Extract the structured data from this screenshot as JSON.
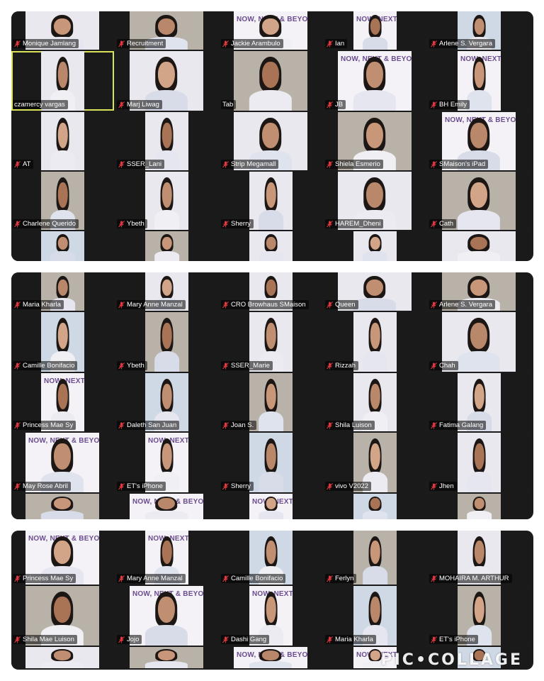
{
  "watermark": "PIC•COLLAGE",
  "brand_banner": "NOW, NEXT & BEYOND.",
  "panels": [
    {
      "rows": [
        [
          "Monique Jamlang",
          "Recruitment",
          "Jackie Arambulo",
          "Ian",
          "Arlene S. Vergara"
        ],
        [
          "czamercy vargas",
          "Marj Liwag",
          "Tab",
          "JB",
          "BH Emily"
        ],
        [
          "AT",
          "SSER_Lani",
          "Strip Megamall",
          "Shiela Esmerio",
          "SMaison's iPad"
        ],
        [
          "Charlene Querido",
          "Ybeth",
          "Sherry",
          "HAREM_Dheni",
          "Cath"
        ],
        [
          "",
          "",
          "",
          "",
          ""
        ]
      ],
      "active": "czamercy vargas"
    },
    {
      "rows": [
        [
          "Maria Kharla",
          "Mary Anne Manzal",
          "CRO Browhaus SMaison",
          "Queen",
          "Arlene S. Vergara"
        ],
        [
          "Camille Bonifacio",
          "Ybeth",
          "SSER_Marie",
          "Rizzah",
          "Chah"
        ],
        [
          "Princess Mae Sy",
          "Daleth San Juan",
          "Joan S.",
          "Shila Luison",
          "Fatima Galang"
        ],
        [
          "May Rose Abril",
          "ET's iPhone",
          "Sherry",
          "vivo V2022",
          "Jhen"
        ],
        [
          "",
          "",
          "",
          "",
          ""
        ]
      ]
    },
    {
      "rows": [
        [
          "Princess Mae Sy",
          "Mary Anne Manzal",
          "Camille Bonifacio",
          "Ferlyn",
          "MOHAIRA M. ARTHUR"
        ],
        [
          "Shila Mae Luison",
          "Jojo",
          "Dashi Gang",
          "Maria Kharla",
          "ET's iPhone"
        ],
        [
          "",
          "",
          "",
          "",
          ""
        ]
      ]
    }
  ],
  "colors": {
    "panel_bg": "#1b1b1b",
    "active_border": "#d8e35a",
    "mic_muted": "#e0383e",
    "brand": "#6b4d8f"
  }
}
